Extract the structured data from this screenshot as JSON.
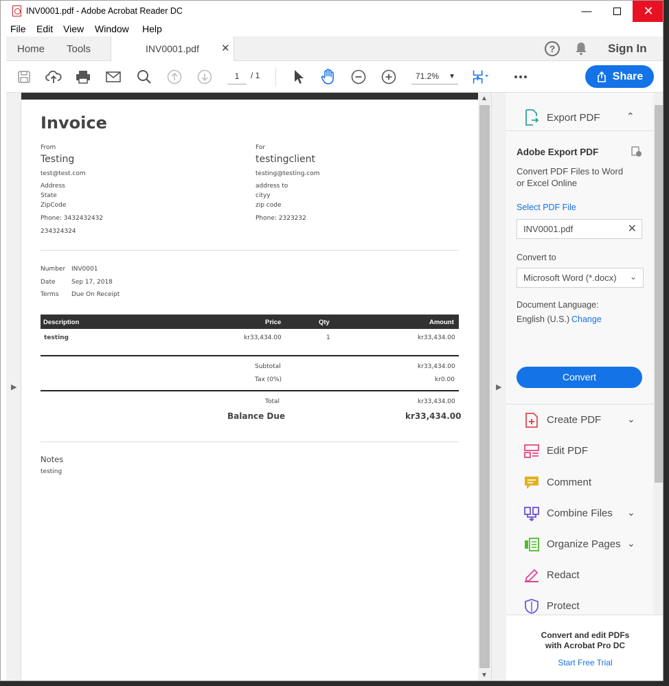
{
  "window": {
    "title": "INV0001.pdf - Adobe Acrobat Reader DC"
  },
  "menu": [
    "File",
    "Edit",
    "View",
    "Window",
    "Help"
  ],
  "tabs": {
    "home": "Home",
    "tools": "Tools",
    "doc": "INV0001.pdf",
    "signin": "Sign In"
  },
  "toolbar": {
    "page_current": "1",
    "page_total": "/ 1",
    "zoom": "71.2%",
    "share": "Share"
  },
  "invoice": {
    "title": "Invoice",
    "from_label": "From",
    "from_name": "Testing",
    "from_email": "test@test.com",
    "from_address": [
      "Address",
      "State",
      "ZipCode"
    ],
    "from_phone": "Phone: 3432432432",
    "from_extra": "234324324",
    "for_label": "For",
    "for_name": "testingclient",
    "for_email": "testing@testing.com",
    "for_address": [
      "address to",
      "cityy",
      "zip code"
    ],
    "for_phone": "Phone: 2323232",
    "number_label": "Number",
    "number": "INV0001",
    "date_label": "Date",
    "date": "Sep 17, 2018",
    "terms_label": "Terms",
    "terms": "Due On Receipt",
    "columns": [
      "Description",
      "Price",
      "Qty",
      "Amount"
    ],
    "items": [
      {
        "description": "testing",
        "price": "kr33,434.00",
        "qty": "1",
        "amount": "kr33,434.00"
      }
    ],
    "subtotal_label": "Subtotal",
    "subtotal": "kr33,434.00",
    "tax_label": "Tax (0%)",
    "tax": "kr0.00",
    "total_label": "Total",
    "total": "kr33,434.00",
    "balance_label": "Balance Due",
    "balance": "kr33,434.00",
    "notes_label": "Notes",
    "notes": "testing"
  },
  "panel": {
    "export_title": "Export PDF",
    "adobe_export": "Adobe Export PDF",
    "desc_1": "Convert PDF Files to Word",
    "desc_2": "or Excel Online",
    "select_file": "Select PDF File",
    "file_name": "INV0001.pdf",
    "convert_to": "Convert to",
    "format": "Microsoft Word (*.docx)",
    "lang_label": "Document Language:",
    "lang_value": "English (U.S.)",
    "change": "Change",
    "convert_btn": "Convert",
    "tools": [
      {
        "label": "Create PDF",
        "icon": "create-pdf-icon",
        "color": "#e34850",
        "expand": true
      },
      {
        "label": "Edit PDF",
        "icon": "edit-pdf-icon",
        "color": "#e34882",
        "expand": false
      },
      {
        "label": "Comment",
        "icon": "comment-icon",
        "color": "#e0b21f",
        "expand": false
      },
      {
        "label": "Combine Files",
        "icon": "combine-files-icon",
        "color": "#6b4fd8",
        "expand": true
      },
      {
        "label": "Organize Pages",
        "icon": "organize-pages-icon",
        "color": "#4fbb2c",
        "expand": true
      },
      {
        "label": "Redact",
        "icon": "redact-icon",
        "color": "#e0438f",
        "expand": false
      },
      {
        "label": "Protect",
        "icon": "protect-icon",
        "color": "#6b5bd8",
        "expand": false
      }
    ],
    "promo_1": "Convert and edit PDFs",
    "promo_2": "with Acrobat Pro DC",
    "trial": "Start Free Trial"
  },
  "colors": {
    "accent": "#1473e6",
    "close": "#e81123"
  }
}
